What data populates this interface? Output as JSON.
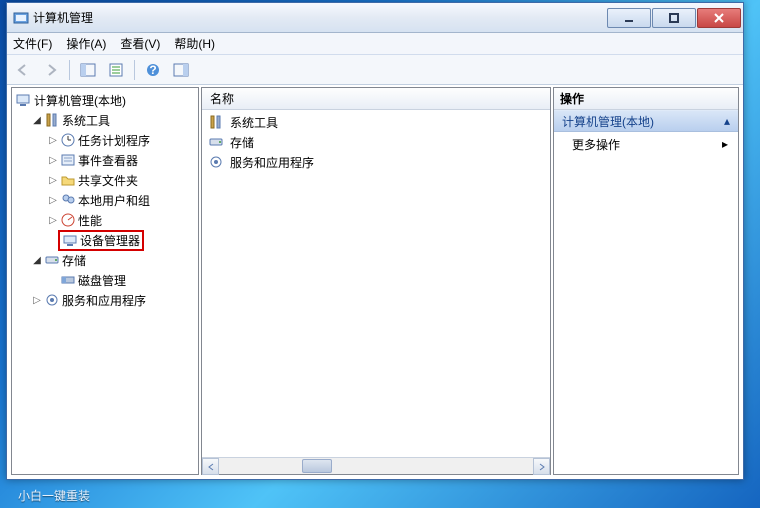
{
  "window": {
    "title": "计算机管理"
  },
  "menu": {
    "file": "文件(F)",
    "action": "操作(A)",
    "view": "查看(V)",
    "help": "帮助(H)"
  },
  "tree": {
    "root": "计算机管理(本地)",
    "system_tools": {
      "label": "系统工具",
      "task_scheduler": "任务计划程序",
      "event_viewer": "事件查看器",
      "shared_folders": "共享文件夹",
      "local_users": "本地用户和组",
      "performance": "性能",
      "device_manager": "设备管理器"
    },
    "storage": {
      "label": "存储",
      "disk_management": "磁盘管理"
    },
    "services": {
      "label": "服务和应用程序"
    }
  },
  "mid": {
    "header": "名称",
    "items": {
      "system_tools": "系统工具",
      "storage": "存储",
      "services": "服务和应用程序"
    }
  },
  "actions": {
    "header": "操作",
    "section_title": "计算机管理(本地)",
    "more": "更多操作"
  },
  "taskbar": {
    "fragment": "小白一键重装"
  }
}
